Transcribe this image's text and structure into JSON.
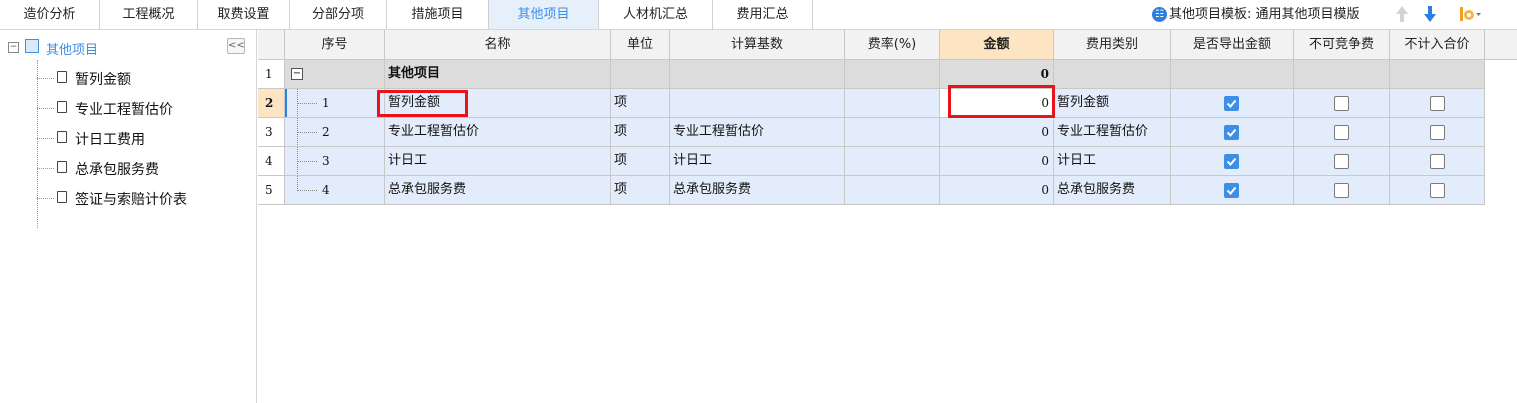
{
  "tabs": [
    {
      "label": "造价分析"
    },
    {
      "label": "工程概况"
    },
    {
      "label": "取费设置"
    },
    {
      "label": "分部分项"
    },
    {
      "label": "措施项目"
    },
    {
      "label": "其他项目"
    },
    {
      "label": "人材机汇总"
    },
    {
      "label": "费用汇总"
    }
  ],
  "active_tab": "其他项目",
  "template": {
    "text": "其他项目模板: 通用其他项目模版",
    "icons": [
      "info-icon",
      "arrow-up-icon",
      "arrow-down-icon",
      "settings-icon"
    ]
  },
  "tree": {
    "collapse_label": "<<",
    "root": "其他项目",
    "items": [
      "暂列金额",
      "专业工程暂估价",
      "计日工费用",
      "总承包服务费",
      "签证与索赔计价表"
    ]
  },
  "table": {
    "headers": [
      "序号",
      "名称",
      "单位",
      "计算基数",
      "费率(%)",
      "金额",
      "费用类别",
      "是否导出金额",
      "不可竞争费",
      "不计入合价"
    ],
    "selected_header": "金额",
    "rows": [
      {
        "num": "1",
        "seq": "",
        "name": "其他项目",
        "unit": "",
        "base": "",
        "rate": "",
        "amount": "0",
        "category": "",
        "export": null,
        "noncompete": null,
        "exclude": null
      },
      {
        "num": "2",
        "seq": "1",
        "name": "暂列金额",
        "unit": "项",
        "base": "",
        "rate": "",
        "amount": "0",
        "category": "暂列金额",
        "export": true,
        "noncompete": false,
        "exclude": false
      },
      {
        "num": "3",
        "seq": "2",
        "name": "专业工程暂估价",
        "unit": "项",
        "base": "专业工程暂估价",
        "rate": "",
        "amount": "0",
        "category": "专业工程暂估价",
        "export": true,
        "noncompete": false,
        "exclude": false
      },
      {
        "num": "4",
        "seq": "3",
        "name": "计日工",
        "unit": "项",
        "base": "计日工",
        "rate": "",
        "amount": "0",
        "category": "计日工",
        "export": true,
        "noncompete": false,
        "exclude": false
      },
      {
        "num": "5",
        "seq": "4",
        "name": "总承包服务费",
        "unit": "项",
        "base": "总承包服务费",
        "rate": "",
        "amount": "0",
        "category": "总承包服务费",
        "export": true,
        "noncompete": false,
        "exclude": false
      }
    ]
  },
  "colors": {
    "accent": "#3b8fe3",
    "selected_header_bg": "#fde5c3",
    "group_row_bg": "#dcdcdc",
    "row_bg": "#e3ecfa",
    "highlight_box": "#e8141c",
    "checkbox_on": "#3d8ee6"
  }
}
